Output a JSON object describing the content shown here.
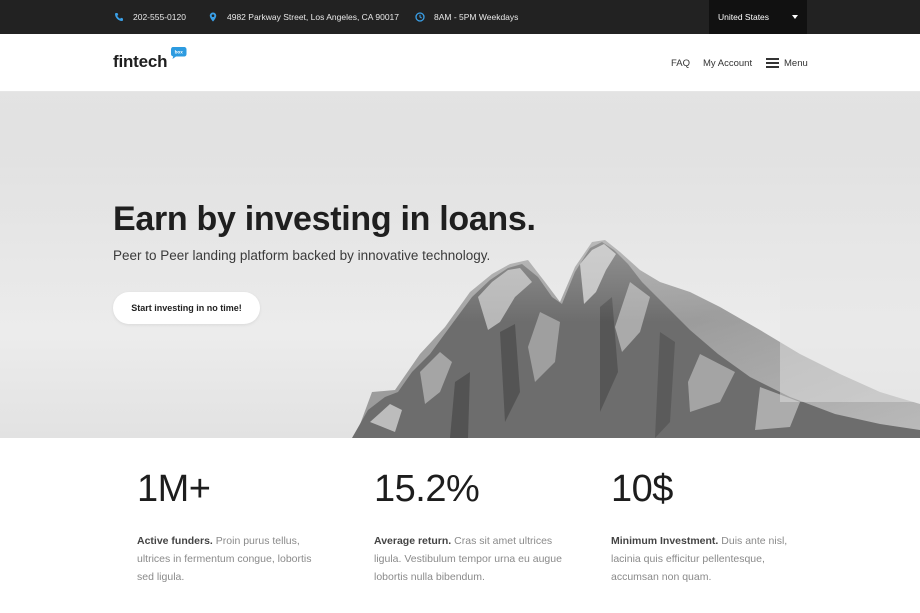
{
  "topbar": {
    "phone": "202-555-0120",
    "address": "4982 Parkway Street, Los Angeles, CA 90017",
    "hours": "8AM - 5PM Weekdays",
    "country": "United States",
    "icon_color": "#3aa0e8"
  },
  "header": {
    "logo": "fintech",
    "logo_badge_text": "box",
    "logo_badge_color": "#2d9be0",
    "nav": {
      "faq": "FAQ",
      "account": "My Account",
      "menu": "Menu"
    }
  },
  "hero": {
    "title": "Earn by investing in loans.",
    "subtitle": "Peer to Peer landing platform backed by innovative technology.",
    "cta": "Start investing in no time!"
  },
  "stats": [
    {
      "value": "1M+",
      "label": "Active funders.",
      "text": " Proin purus tellus, ultrices in fermentum congue, lobortis sed ligula."
    },
    {
      "value": "15.2%",
      "label": "Average return.",
      "text": " Cras sit amet ultrices ligula. Vestibulum tempor urna eu augue lobortis nulla bibendum."
    },
    {
      "value": "10$",
      "label": "Minimum Investment.",
      "text": " Duis ante nisl, lacinia quis efficitur pellentesque, accumsan non quam."
    }
  ]
}
